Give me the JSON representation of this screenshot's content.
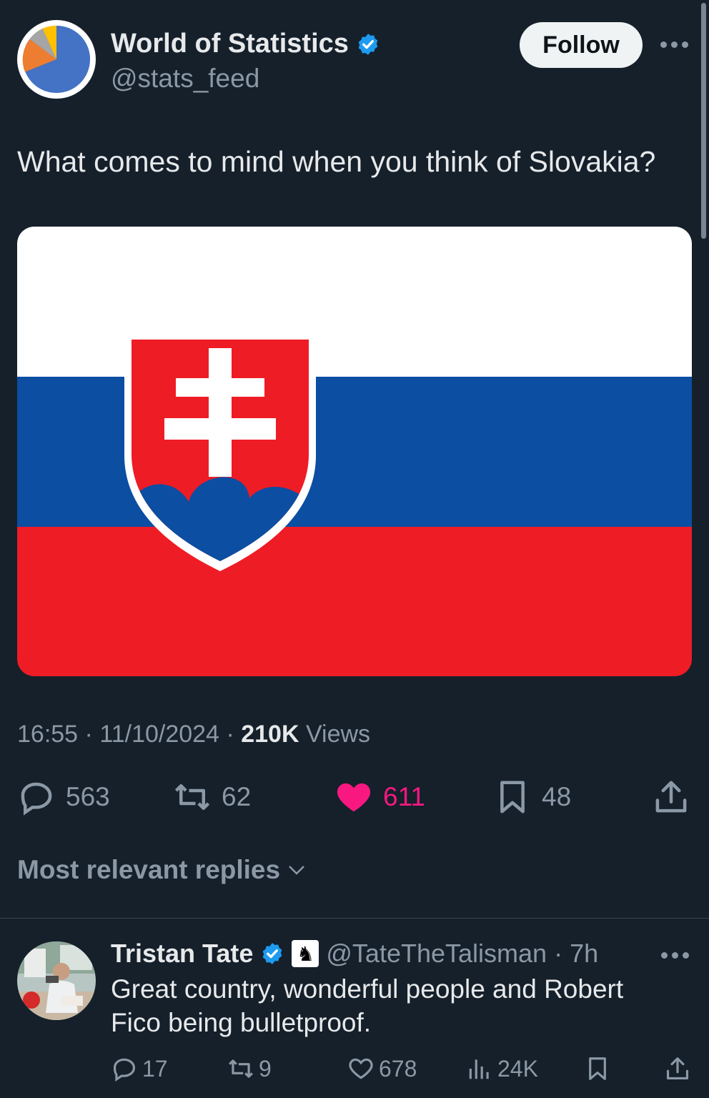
{
  "author": {
    "display_name": "World of Statistics",
    "handle": "@stats_feed",
    "follow_label": "Follow"
  },
  "tweet": {
    "text": "What comes to mind when you think of Slovakia?",
    "image": "slovakia-flag",
    "time": "16:55",
    "date": "11/10/2024",
    "views_count": "210K",
    "views_label": "Views",
    "separator": "·"
  },
  "stats": {
    "replies": "563",
    "reposts": "62",
    "likes": "611",
    "bookmarks": "48"
  },
  "replies_sort_label": "Most relevant replies",
  "reply": {
    "display_name": "Tristan Tate",
    "badge_icon": "chess-knight-icon",
    "handle": "@TateTheTalisman",
    "separator": "·",
    "age": "7h",
    "text": "Great country, wonderful people and Robert Fico being bulletproof.",
    "stats": {
      "replies": "17",
      "reposts": "9",
      "likes": "678",
      "views": "24K"
    }
  },
  "colors": {
    "background": "#15202b",
    "verified": "#1d9bf0",
    "like": "#f91880",
    "flag_blue": "#0b4ea2",
    "flag_red": "#ee1c25"
  }
}
